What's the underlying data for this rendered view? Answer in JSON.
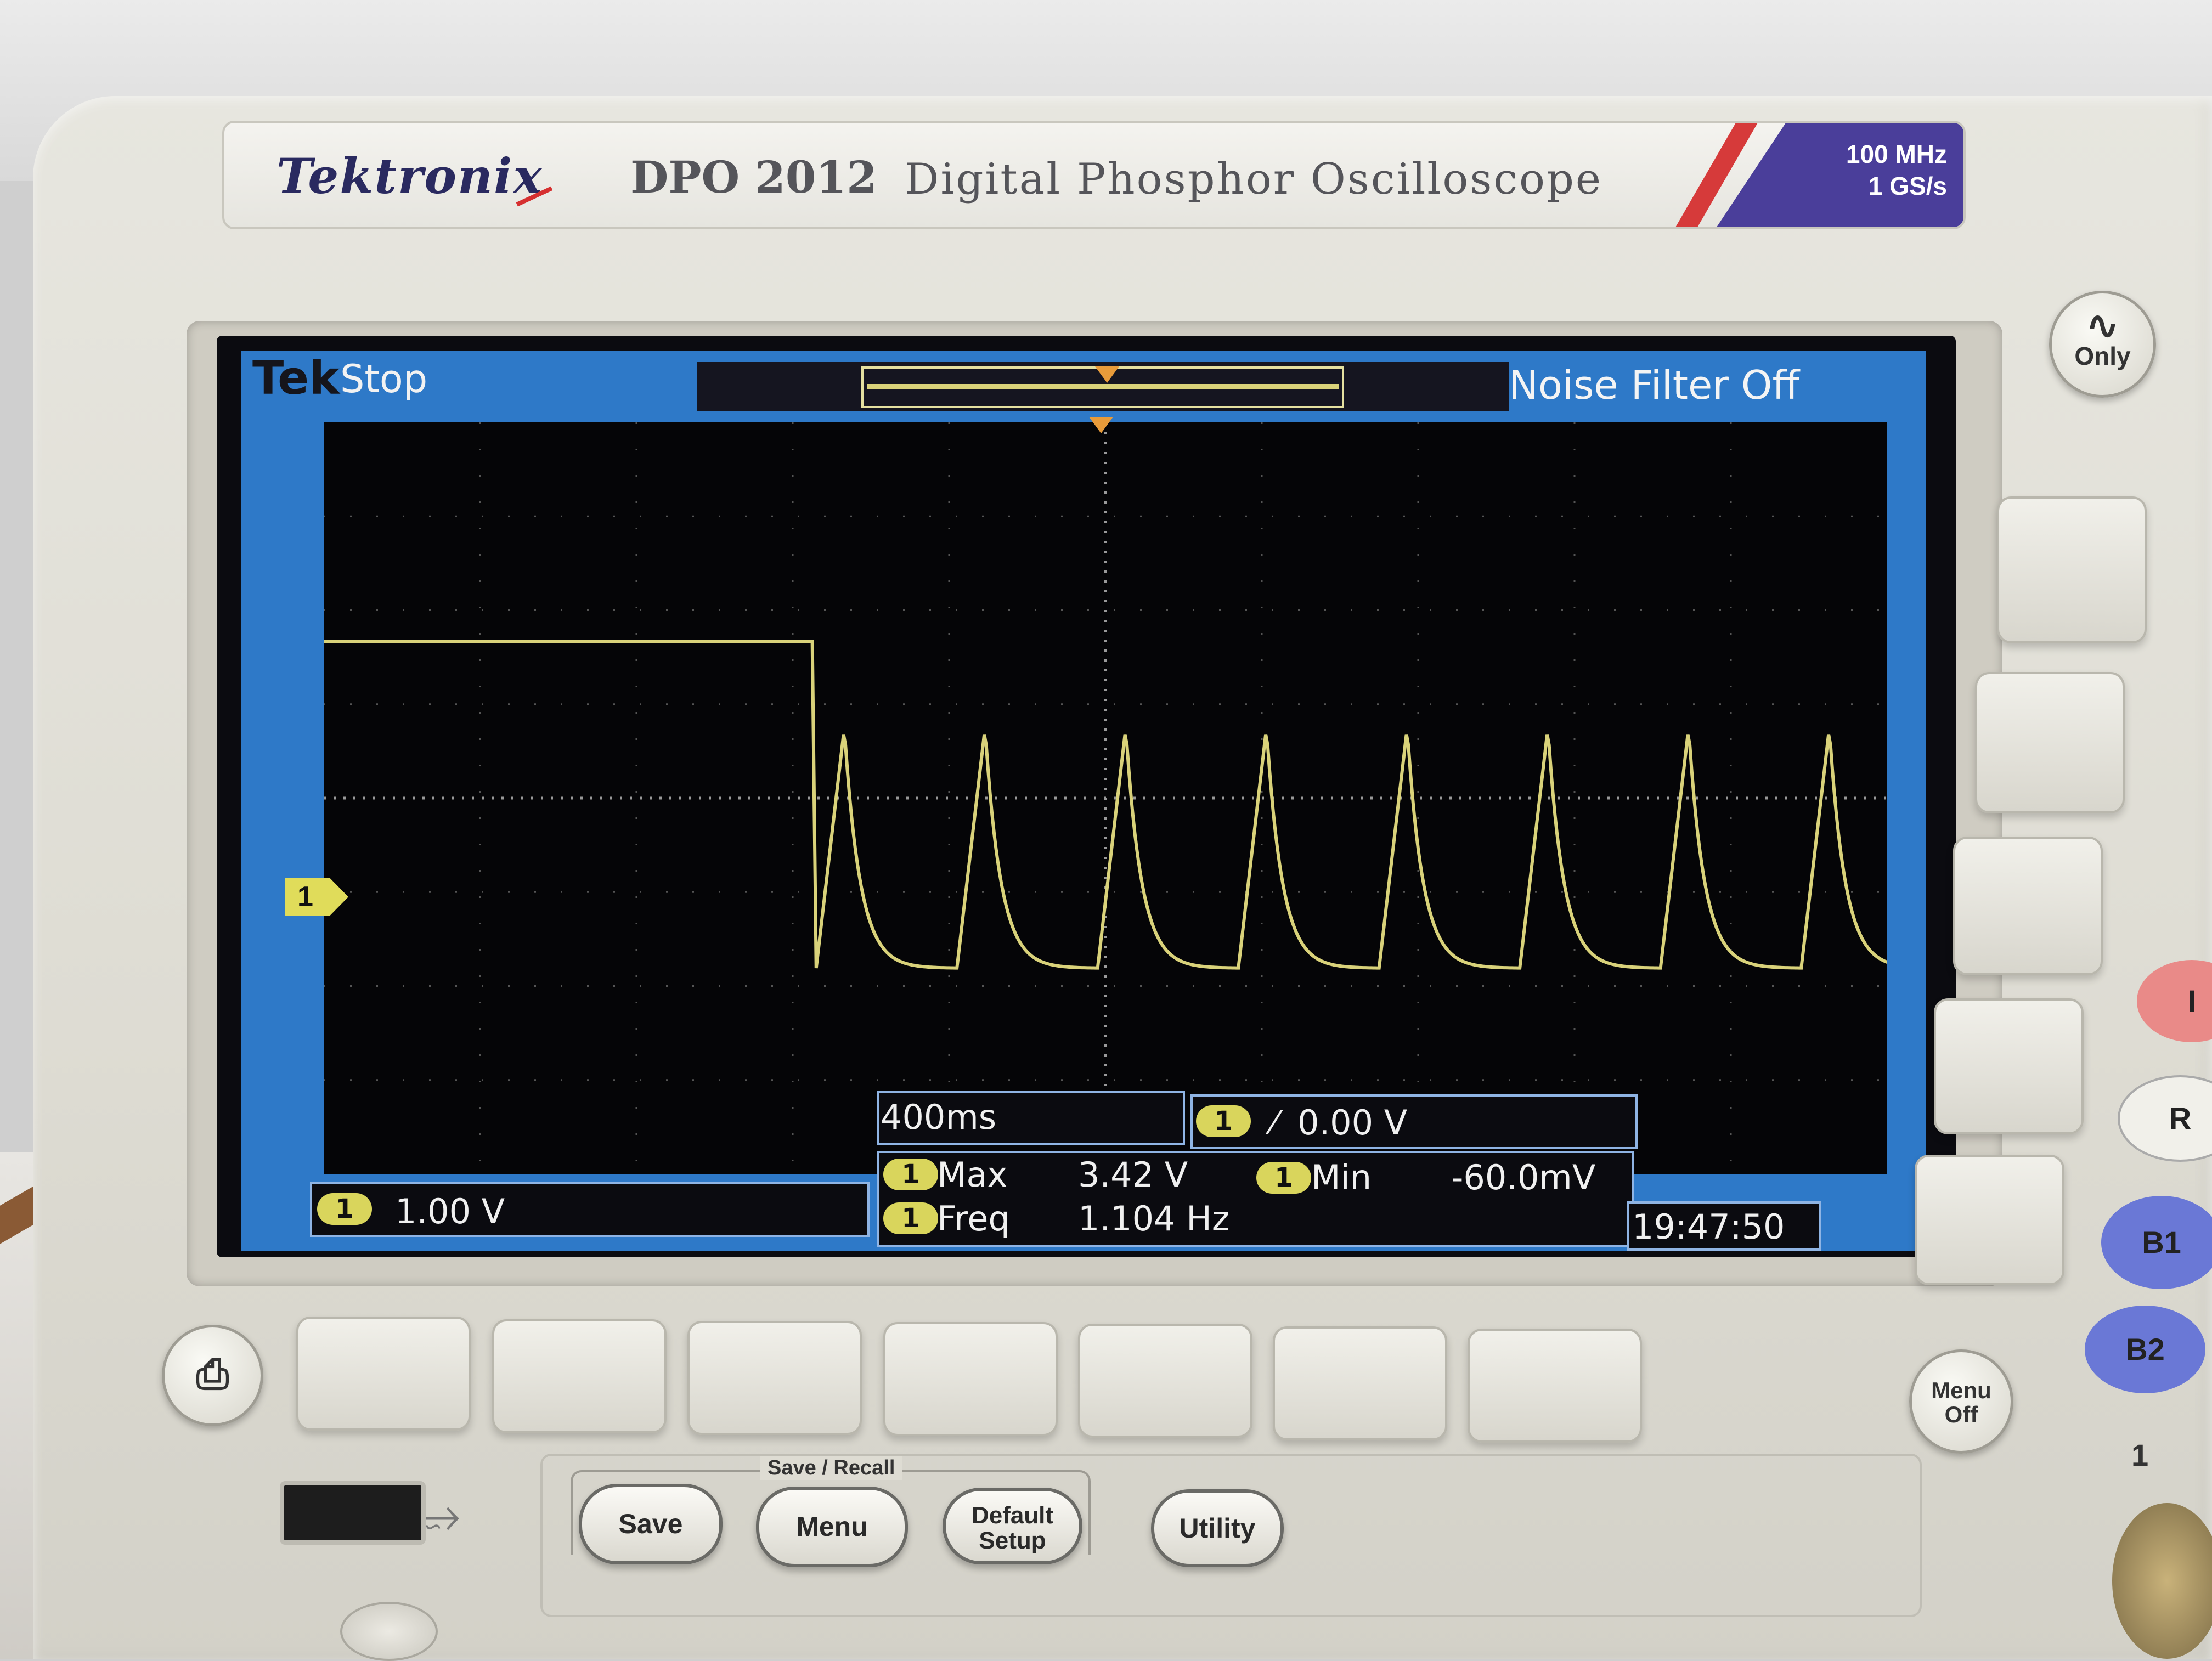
{
  "brand": {
    "logo": "Tektronix",
    "model": "DPO 2012",
    "description": "Digital Phosphor Oscilloscope",
    "bandwidth": "100 MHz",
    "sample_rate": "1 GS/s"
  },
  "status": {
    "tek_logo": "Tek",
    "acquisition_state": "Stop",
    "noise_filter": "Noise Filter Off"
  },
  "channel": {
    "badge": "1",
    "vertical_scale": "1.00 V",
    "marker": "1"
  },
  "timebase": "400ms",
  "trigger": {
    "badge": "1",
    "edge_icon": "rising-edge-icon",
    "level": "0.00 V"
  },
  "measurements": [
    {
      "badge": "1",
      "label": "Max",
      "value": "3.42 V"
    },
    {
      "badge": "1",
      "label": "Min",
      "value": "-60.0mV"
    },
    {
      "badge": "1",
      "label": "Freq",
      "value": "1.104 Hz"
    }
  ],
  "clock": "19:47:50",
  "buttons": {
    "hard_copy_icon": "printer-icon",
    "save_recall_group": "Save / Recall",
    "save": "Save",
    "menu": "Menu",
    "default_setup_line1": "Default",
    "default_setup_line2": "Setup",
    "utility": "Utility",
    "run_only_line1": "∿",
    "run_only_line2": "Only",
    "menu_off_line1": "Menu",
    "menu_off_line2": "Off",
    "b1": "B1",
    "b2": "B2",
    "side_partial_1": "I",
    "side_partial_2": "R",
    "input_label": "1"
  },
  "waveform": {
    "trace_color": "#d9d27a",
    "volts_per_div": 1.0,
    "seconds_per_div": 0.4,
    "vertical_divisions": 8,
    "horizontal_divisions": 10,
    "channel_offset_div_from_top": 5.75,
    "stop_time_s": 1.25,
    "pre_level_V": 3.42,
    "osc_max_V": 2.5,
    "osc_min_V": -0.06,
    "frequency_Hz": 1.104
  },
  "colors": {
    "screen_frame": "#2e79c8",
    "channel1": "#d9d55c",
    "trigger_marker": "#e89b3a",
    "badge": "#4a3e9a"
  }
}
